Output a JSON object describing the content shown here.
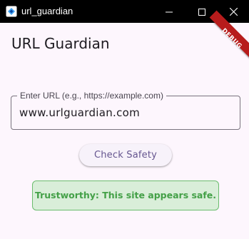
{
  "window": {
    "title": "url_guardian",
    "minimize_icon": "minimize-icon",
    "maximize_icon": "maximize-icon",
    "close_icon": "close-icon"
  },
  "app": {
    "title": "URL Guardian",
    "debug_banner": "DEBUG"
  },
  "url_field": {
    "label": "Enter URL (e.g., https://example.com)",
    "value": "www.urlguardian.com"
  },
  "check_button": {
    "label": "Check Safety"
  },
  "result": {
    "message": "Trustworthy: This site appears safe.",
    "status": "safe"
  },
  "colors": {
    "accent": "#65558f",
    "success_text": "#43a047",
    "success_bg": "#d9eed9",
    "debug_banner": "#b71c1c",
    "titlebar": "#000000"
  }
}
